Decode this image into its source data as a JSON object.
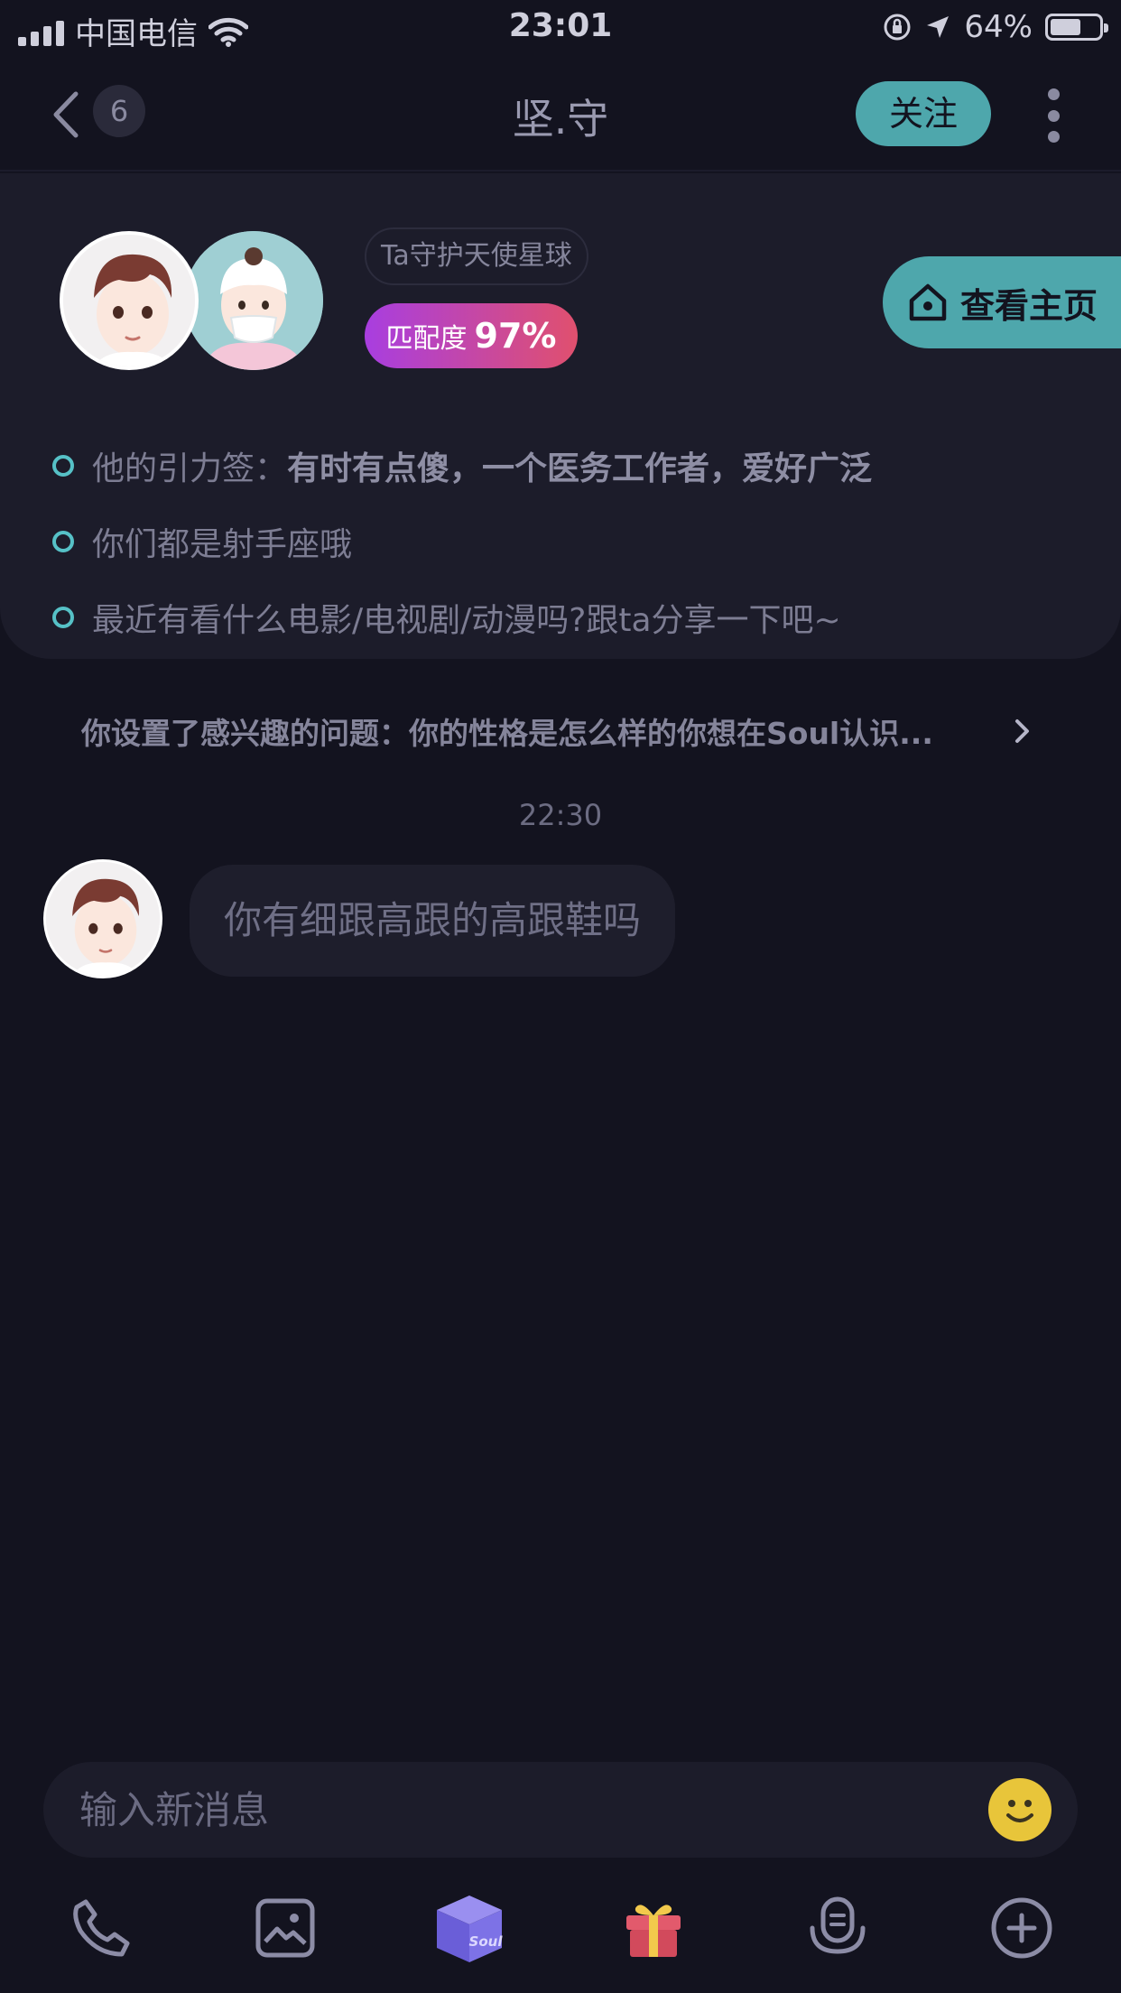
{
  "status_bar": {
    "carrier": "中国电信",
    "time": "23:01",
    "battery_percent": "64%",
    "battery_level": 0.64
  },
  "nav": {
    "unread_count": "6",
    "title": "坚.守",
    "follow_label": "关注"
  },
  "profile": {
    "planet_tag": "Ta守护天使星球",
    "match_label": "匹配度",
    "match_value": "97%",
    "homepage_label": "查看主页",
    "tips": [
      {
        "prefix": "他的引力签：",
        "bold": "有时有点傻，一个医务工作者，爱好广泛"
      },
      {
        "prefix": "你们都是射手座哦",
        "bold": ""
      },
      {
        "prefix": "最近有看什么电影/电视剧/动漫吗?跟ta分享一下吧~",
        "bold": ""
      }
    ]
  },
  "interest": {
    "text": "你设置了感兴趣的问题：你的性格是怎么样的你想在Soul认识..."
  },
  "chat": {
    "timestamp": "22:30",
    "messages": [
      {
        "text": "你有细跟高跟的高跟鞋吗"
      }
    ]
  },
  "input": {
    "placeholder": "输入新消息"
  },
  "toolbar": {
    "box_label": "Soul",
    "icons": [
      "phone-icon",
      "image-icon",
      "soul-box-icon",
      "gift-icon",
      "voice-icon",
      "plus-icon"
    ]
  },
  "colors": {
    "background": "#13131f",
    "card": "#1c1c2a",
    "accent_teal": "#4ea7ac",
    "match_gradient_start": "#a83ee0",
    "match_gradient_end": "#e0506e",
    "emoji_yellow": "#e8c53a"
  }
}
